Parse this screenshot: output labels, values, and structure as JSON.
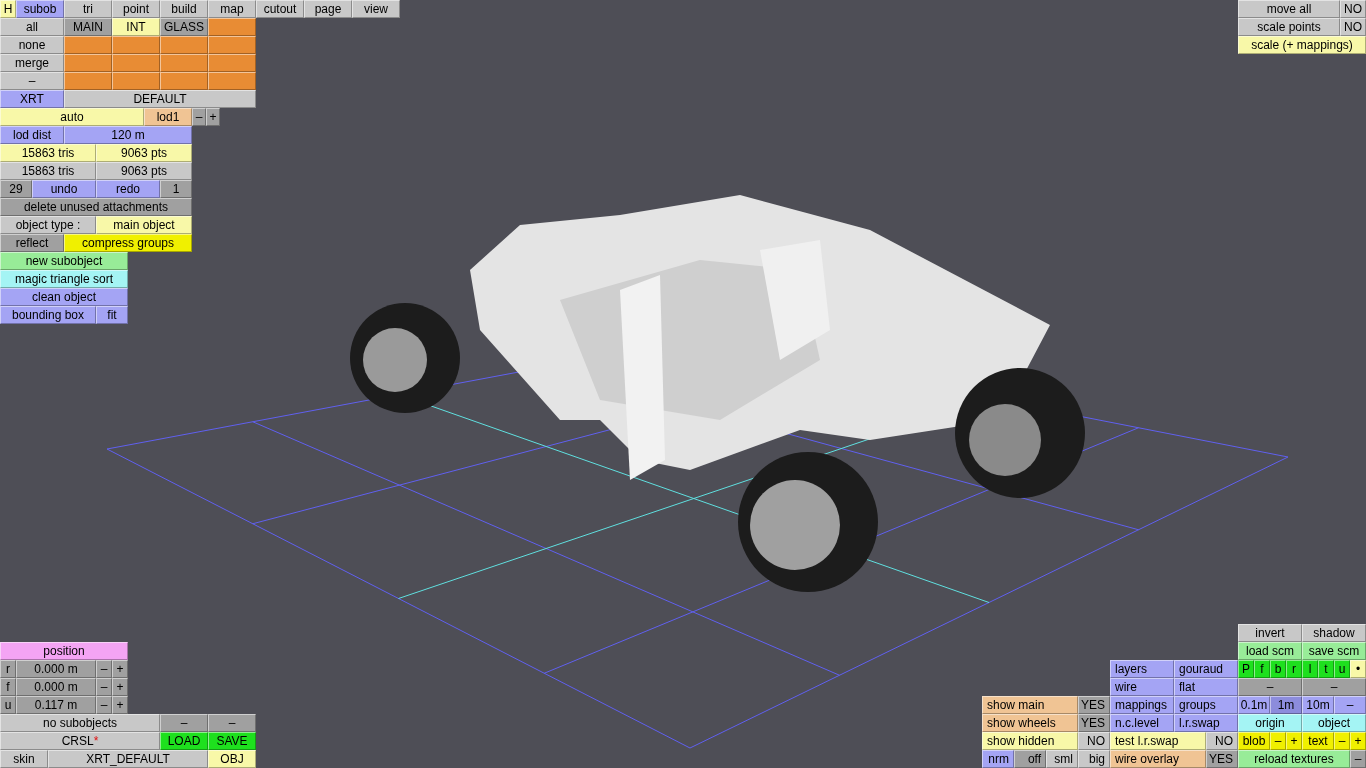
{
  "panels": [
    {
      "strips": [
        {
          "buttons": [
            {
              "label": "H",
              "kind": "yellow"
            },
            {
              "label": "subob",
              "kind": "blue"
            },
            {
              "label": "tri",
              "kind": "light"
            },
            {
              "label": "point",
              "kind": "light"
            },
            {
              "label": "build",
              "kind": "light"
            },
            {
              "label": "map",
              "kind": "light"
            },
            {
              "label": "cutout",
              "kind": "light"
            },
            {
              "label": "page",
              "kind": "light"
            },
            {
              "label": "view",
              "kind": "light"
            }
          ]
        },
        {
          "buttons": [
            {
              "label": "all",
              "kind": "light"
            },
            {
              "label": "MAIN",
              "kind": "dark"
            },
            {
              "label": "INT",
              "kind": "yellow"
            },
            {
              "label": "GLASS",
              "kind": "dark"
            },
            {
              "kind": "orange"
            }
          ]
        },
        {
          "buttons": [
            {
              "label": "none",
              "kind": "light"
            },
            {
              "kind": "orange"
            },
            {
              "kind": "orange"
            },
            {
              "kind": "orange"
            },
            {
              "kind": "orange"
            }
          ]
        },
        {
          "buttons": [
            {
              "label": "merge",
              "kind": "light"
            },
            {
              "kind": "orange"
            },
            {
              "kind": "orange"
            },
            {
              "kind": "orange"
            },
            {
              "kind": "orange"
            }
          ]
        },
        {
          "buttons": [
            {
              "label": "–",
              "kind": "light"
            },
            {
              "kind": "orange"
            },
            {
              "kind": "orange"
            },
            {
              "kind": "orange"
            },
            {
              "kind": "orange"
            }
          ]
        },
        {
          "buttons": [
            {
              "label": "XRT",
              "kind": "blue"
            },
            {
              "label": "DEFAULT",
              "kind": "light"
            }
          ]
        },
        {
          "buttons": [
            {
              "label": "auto",
              "kind": "yellow"
            },
            {
              "label": "lod1",
              "kind": "salmon"
            },
            {
              "label": "–",
              "kind": "dark"
            },
            {
              "label": "+",
              "kind": "dark"
            }
          ]
        },
        {
          "buttons": [
            {
              "label": "lod dist",
              "kind": "blue"
            },
            {
              "label": "120 m",
              "kind": "blue"
            }
          ]
        },
        {
          "buttons": [
            {
              "label": "15863 tris",
              "kind": "yellow"
            },
            {
              "label": "9063 pts",
              "kind": "yellow"
            }
          ]
        },
        {
          "buttons": [
            {
              "label": "15863 tris",
              "kind": "light"
            },
            {
              "label": "9063 pts",
              "kind": "light"
            }
          ]
        },
        {
          "buttons": [
            {
              "label": "29",
              "kind": "dark"
            },
            {
              "label": "undo",
              "kind": "blue"
            },
            {
              "label": "redo",
              "kind": "blue"
            },
            {
              "label": "1",
              "kind": "dark"
            }
          ]
        },
        {
          "buttons": [
            {
              "label": "delete unused attachments",
              "kind": "dark"
            }
          ]
        },
        {
          "buttons": [
            {
              "label": "object type :",
              "kind": "light"
            },
            {
              "label": "main object",
              "kind": "yellow"
            }
          ]
        },
        {
          "buttons": [
            {
              "label": "reflect",
              "kind": "dark"
            },
            {
              "label": "compress groups",
              "kind": "bright"
            }
          ]
        },
        {
          "buttons": [
            {
              "label": "new subobject",
              "kind": "green"
            }
          ]
        },
        {
          "buttons": [
            {
              "label": "magic triangle sort",
              "kind": "cyan"
            }
          ]
        },
        {
          "buttons": [
            {
              "label": "clean object",
              "kind": "blue"
            }
          ]
        },
        {
          "buttons": [
            {
              "label": "bounding box",
              "kind": "blue"
            },
            {
              "label": "fit",
              "kind": "blue"
            }
          ]
        }
      ]
    },
    {
      "strips": [
        {
          "buttons": [
            {
              "label": "move all",
              "kind": "light"
            },
            {
              "label": "NO",
              "kind": "light"
            }
          ]
        },
        {
          "buttons": [
            {
              "label": "scale points",
              "kind": "light"
            },
            {
              "label": "NO",
              "kind": "light"
            }
          ]
        },
        {
          "buttons": [
            {
              "label": "scale (+ mappings)",
              "kind": "yellow"
            }
          ]
        }
      ]
    },
    {
      "strips": [
        {
          "buttons": [
            {
              "label": "position",
              "kind": "pink"
            }
          ]
        },
        {
          "buttons": [
            {
              "label": "r",
              "kind": "dark"
            },
            {
              "label": "0.000 m",
              "kind": "dark"
            },
            {
              "label": "–",
              "kind": "dark"
            },
            {
              "label": "+",
              "kind": "dark"
            }
          ]
        },
        {
          "buttons": [
            {
              "label": "f",
              "kind": "dark"
            },
            {
              "label": "0.000 m",
              "kind": "dark"
            },
            {
              "label": "–",
              "kind": "dark"
            },
            {
              "label": "+",
              "kind": "dark"
            }
          ]
        },
        {
          "buttons": [
            {
              "label": "u",
              "kind": "dark"
            },
            {
              "label": "0.117 m",
              "kind": "dark"
            },
            {
              "label": "–",
              "kind": "dark"
            },
            {
              "label": "+",
              "kind": "dark"
            }
          ]
        },
        {
          "buttons": [
            {
              "label": "no subobjects",
              "kind": "light"
            },
            {
              "label": "–",
              "kind": "dark"
            },
            {
              "label": "–",
              "kind": "dark"
            }
          ]
        },
        {
          "buttons": [
            {
              "label": "CRSL",
              "suffix": "*",
              "kind": "light"
            },
            {
              "label": "LOAD",
              "kind": "lime"
            },
            {
              "label": "SAVE",
              "kind": "lime"
            }
          ]
        },
        {
          "buttons": [
            {
              "label": "skin",
              "kind": "light"
            },
            {
              "label": "XRT_DEFAULT",
              "kind": "light"
            },
            {
              "label": "OBJ",
              "kind": "yellow"
            }
          ]
        }
      ]
    },
    {
      "strips": [
        {
          "buttons": [
            {
              "label": "show main",
              "kind": "salmon"
            },
            {
              "label": "YES",
              "kind": "dark"
            }
          ]
        },
        {
          "buttons": [
            {
              "label": "show wheels",
              "kind": "salmon"
            },
            {
              "label": "YES",
              "kind": "dark"
            }
          ]
        },
        {
          "buttons": [
            {
              "label": "show hidden",
              "kind": "yellow"
            },
            {
              "label": "NO",
              "kind": "light"
            }
          ]
        },
        {
          "buttons": [
            {
              "label": "nrm",
              "kind": "blue"
            },
            {
              "label": "off",
              "kind": "dark"
            },
            {
              "label": "sml",
              "kind": "light"
            },
            {
              "label": "big",
              "kind": "light"
            }
          ]
        }
      ]
    },
    {
      "strips": [
        {
          "buttons": [
            {
              "label": "layers",
              "kind": "blue"
            },
            {
              "label": "gouraud",
              "kind": "blue"
            }
          ]
        },
        {
          "buttons": [
            {
              "label": "wire",
              "kind": "blue"
            },
            {
              "label": "flat",
              "kind": "blue"
            }
          ]
        },
        {
          "buttons": [
            {
              "label": "mappings",
              "kind": "blue"
            },
            {
              "label": "groups",
              "kind": "blue"
            }
          ]
        },
        {
          "buttons": [
            {
              "label": "n.c.level",
              "kind": "blue"
            },
            {
              "label": "l.r.swap",
              "kind": "blue"
            }
          ]
        },
        {
          "buttons": [
            {
              "label": "test l.r.swap",
              "kind": "yellow"
            },
            {
              "label": "NO",
              "kind": "light"
            }
          ]
        },
        {
          "buttons": [
            {
              "label": "wire overlay",
              "kind": "salmon"
            },
            {
              "label": "YES",
              "kind": "dark"
            }
          ]
        }
      ]
    },
    {
      "strips": [
        {
          "buttons": [
            {
              "label": "invert",
              "kind": "light"
            },
            {
              "label": "shadow",
              "kind": "light"
            }
          ]
        },
        {
          "buttons": [
            {
              "label": "load scm",
              "kind": "green"
            },
            {
              "label": "save scm",
              "kind": "green"
            }
          ]
        },
        {
          "buttons": [
            {
              "label": "P",
              "kind": "lime"
            },
            {
              "label": "f",
              "kind": "lime"
            },
            {
              "label": "b",
              "kind": "lime"
            },
            {
              "label": "r",
              "kind": "lime"
            },
            {
              "label": "l",
              "kind": "lime"
            },
            {
              "label": "t",
              "kind": "lime"
            },
            {
              "label": "u",
              "kind": "lime"
            },
            {
              "label": "•",
              "kind": "yellow"
            }
          ]
        },
        {
          "buttons": [
            {
              "label": "–",
              "kind": "dark"
            },
            {
              "label": "–",
              "kind": "dark"
            }
          ]
        },
        {
          "buttons": [
            {
              "label": "0.1m",
              "kind": "blue"
            },
            {
              "label": "1m",
              "kind": "indigo"
            },
            {
              "label": "10m",
              "kind": "blue"
            },
            {
              "label": "–",
              "kind": "blue"
            }
          ]
        },
        {
          "buttons": [
            {
              "label": "origin",
              "kind": "cyan"
            },
            {
              "label": "object",
              "kind": "cyan"
            }
          ]
        },
        {
          "buttons": [
            {
              "label": "blob",
              "kind": "bright"
            },
            {
              "label": "–",
              "kind": "bright"
            },
            {
              "label": "+",
              "kind": "bright"
            },
            {
              "label": "text",
              "kind": "bright"
            },
            {
              "label": "–",
              "kind": "bright"
            },
            {
              "label": "+",
              "kind": "bright"
            }
          ]
        },
        {
          "buttons": [
            {
              "label": "reload textures",
              "kind": "green"
            },
            {
              "label": "–",
              "kind": "dark"
            }
          ]
        }
      ]
    }
  ]
}
